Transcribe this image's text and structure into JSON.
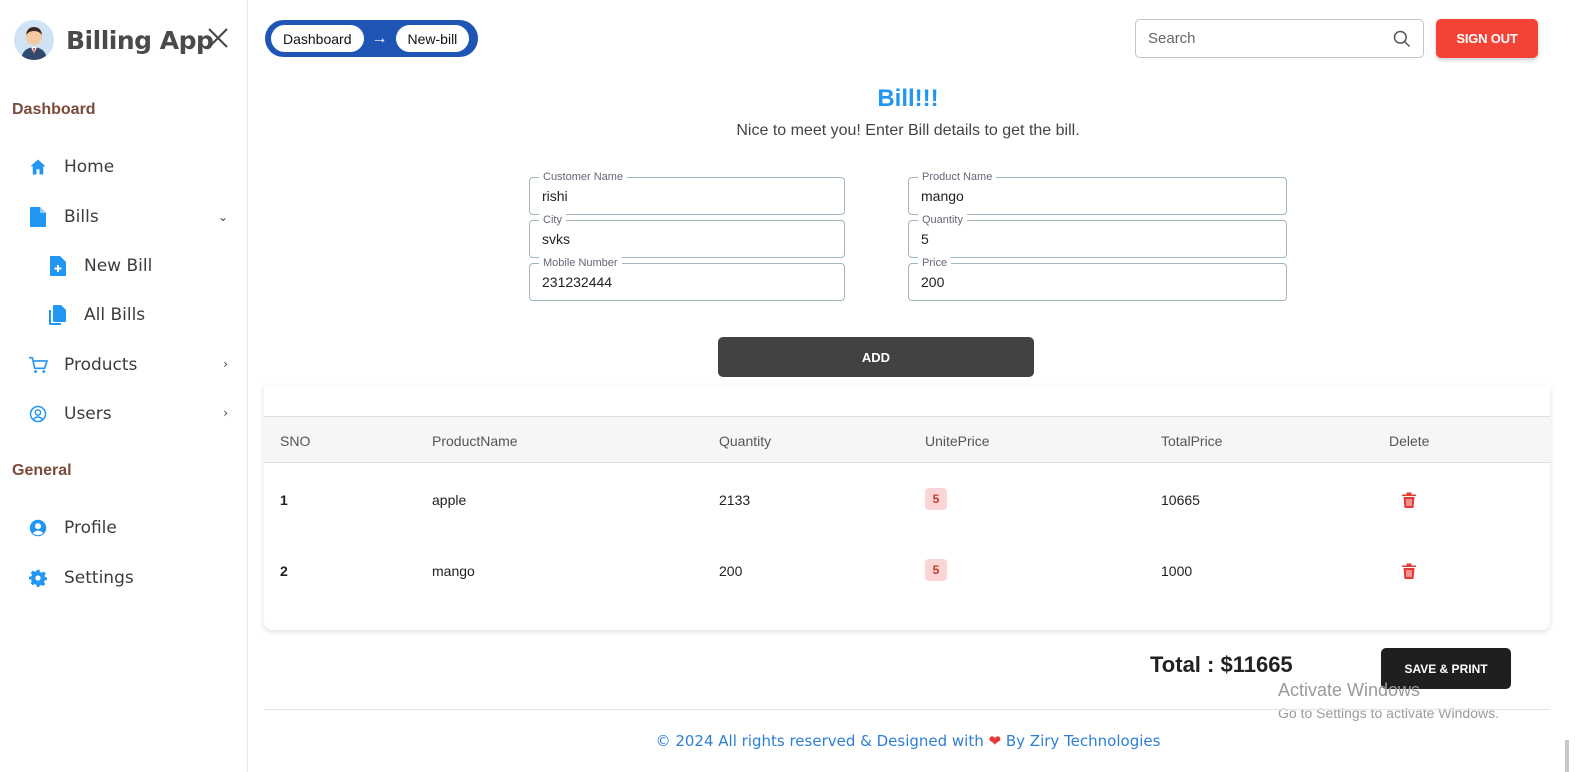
{
  "sidebar": {
    "brand_title": "Billing App",
    "sections": {
      "dashboard": "Dashboard",
      "general": "General"
    },
    "items": {
      "home": "Home",
      "bills": "Bills",
      "new_bill": "New Bill",
      "all_bills": "All Bills",
      "products": "Products",
      "users": "Users",
      "profile": "Profile",
      "settings": "Settings"
    },
    "accent_color": "#2196f3"
  },
  "breadcrumb": {
    "first": "Dashboard",
    "arrow": "→",
    "second": "New-bill"
  },
  "search": {
    "placeholder": "Search",
    "value": ""
  },
  "signout_label": "SIGN OUT",
  "bill": {
    "title": "Bill!!!",
    "subtitle": "Nice to meet you! Enter Bill details to get the bill."
  },
  "form": {
    "customer_name": {
      "label": "Customer Name",
      "value": "rishi"
    },
    "city": {
      "label": "City",
      "value": "svks"
    },
    "mobile": {
      "label": "Mobile Number",
      "value": "231232444"
    },
    "product_name": {
      "label": "Product Name",
      "value": "mango"
    },
    "quantity": {
      "label": "Quantity",
      "value": "5"
    },
    "price": {
      "label": "Price",
      "value": "200"
    }
  },
  "add_label": "ADD",
  "table": {
    "headers": {
      "sno": "SNO",
      "product": "ProductName",
      "quantity": "Quantity",
      "unit": "UnitePrice",
      "total": "TotalPrice",
      "delete": "Delete"
    },
    "rows": [
      {
        "sno": "1",
        "product": "apple",
        "quantity": "2133",
        "unit": "5",
        "total": "10665"
      },
      {
        "sno": "2",
        "product": "mango",
        "quantity": "200",
        "unit": "5",
        "total": "1000"
      }
    ]
  },
  "total_text": "Total : $11665",
  "save_label": "SAVE & PRINT",
  "watermark": {
    "line1": "Activate Windows",
    "line2": "Go to Settings to activate Windows."
  },
  "footer": {
    "before": "© 2024 All rights reserved & Designed with",
    "heart": "❤",
    "after": "By Ziry Technologies"
  }
}
